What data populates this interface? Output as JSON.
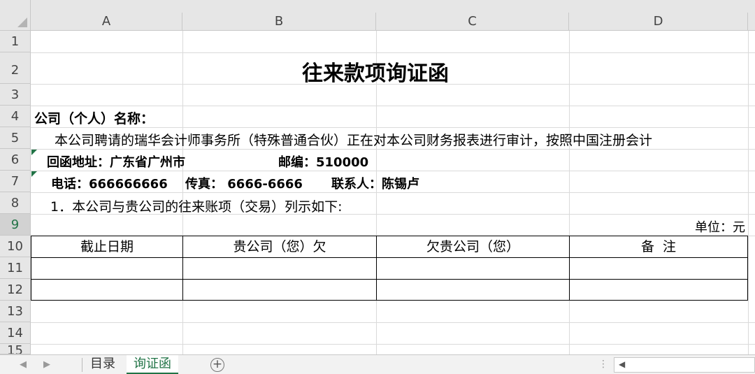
{
  "columns": [
    "A",
    "B",
    "C",
    "D"
  ],
  "rows": [
    "1",
    "2",
    "3",
    "4",
    "5",
    "6",
    "7",
    "8",
    "9",
    "10",
    "11",
    "12",
    "13",
    "14",
    "15"
  ],
  "doc": {
    "title": "往来款项询证函",
    "company_label": "公司（个人）名称：",
    "intro": "本公司聘请的瑞华会计师事务所（特殊普通合伙）正在对本公司财务报表进行审计，按照中国注册会计",
    "address": "回函地址：广东省广州市",
    "postcode": "邮编：510000",
    "phone": "电话：666666666",
    "fax": "传真： 6666-6666",
    "contact": "联系人：陈锡卢",
    "item1": "1．本公司与贵公司的往来账项（交易）列示如下:",
    "unit": "单位：元"
  },
  "table": {
    "headers": [
      "截止日期",
      "贵公司（您）欠",
      "欠贵公司（您）",
      "备  注"
    ],
    "rows": [
      [
        "",
        "",
        "",
        ""
      ],
      [
        "",
        "",
        "",
        ""
      ]
    ]
  },
  "tabs": {
    "items": [
      "目录",
      "询证函"
    ],
    "active": 1
  },
  "selected_row": "9",
  "colors": {
    "accent": "#217346",
    "header_bg": "#e6e6e6"
  }
}
